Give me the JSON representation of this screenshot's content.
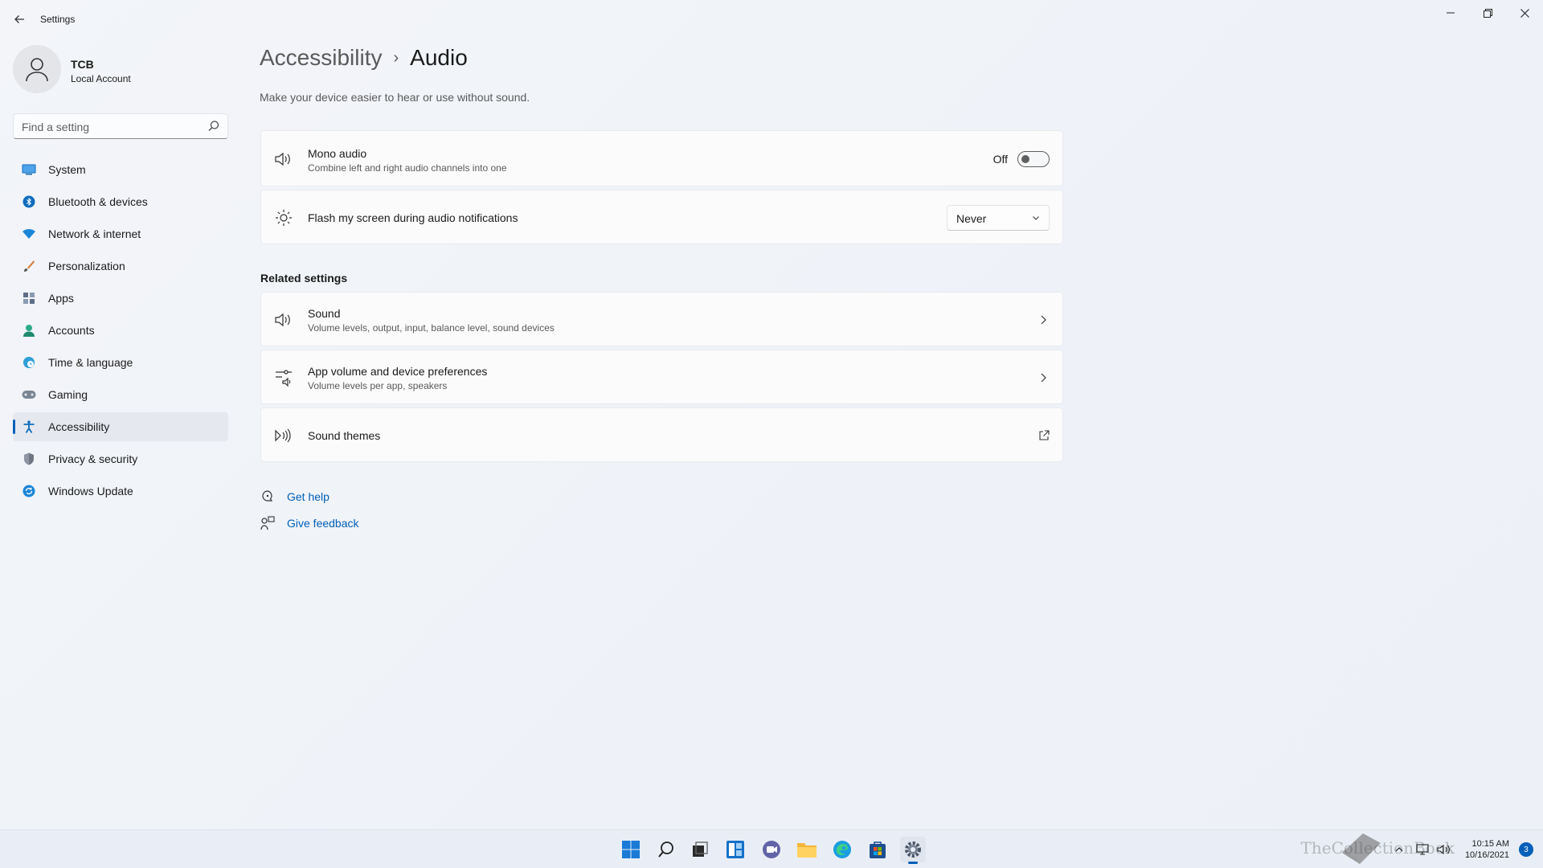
{
  "window": {
    "app_title": "Settings",
    "controls": {
      "minimize": "—",
      "maximize": "❐",
      "close": "✕"
    }
  },
  "profile": {
    "name": "TCB",
    "account_type": "Local Account"
  },
  "search": {
    "placeholder": "Find a setting"
  },
  "sidebar": {
    "items": [
      {
        "label": "System",
        "icon": "monitor-icon",
        "active": false
      },
      {
        "label": "Bluetooth & devices",
        "icon": "bluetooth-icon",
        "active": false
      },
      {
        "label": "Network & internet",
        "icon": "wifi-icon",
        "active": false
      },
      {
        "label": "Personalization",
        "icon": "brush-icon",
        "active": false
      },
      {
        "label": "Apps",
        "icon": "apps-icon",
        "active": false
      },
      {
        "label": "Accounts",
        "icon": "person-icon",
        "active": false
      },
      {
        "label": "Time & language",
        "icon": "globe-clock-icon",
        "active": false
      },
      {
        "label": "Gaming",
        "icon": "gamepad-icon",
        "active": false
      },
      {
        "label": "Accessibility",
        "icon": "accessibility-icon",
        "active": true
      },
      {
        "label": "Privacy & security",
        "icon": "shield-icon",
        "active": false
      },
      {
        "label": "Windows Update",
        "icon": "update-icon",
        "active": false
      }
    ]
  },
  "main": {
    "breadcrumb": {
      "parent": "Accessibility",
      "separator": "›",
      "current": "Audio"
    },
    "description": "Make your device easier to hear or use without sound.",
    "settings": {
      "mono_audio": {
        "title": "Mono audio",
        "subtitle": "Combine left and right audio channels into one",
        "toggle_state": "Off",
        "enabled": false
      },
      "flash_screen": {
        "title": "Flash my screen during audio notifications",
        "selected": "Never"
      }
    },
    "related": {
      "heading": "Related settings",
      "items": [
        {
          "title": "Sound",
          "subtitle": "Volume levels, output, input, balance level, sound devices",
          "icon": "speaker-icon",
          "action": "chevron-right-icon"
        },
        {
          "title": "App volume and device preferences",
          "subtitle": "Volume levels per app, speakers",
          "icon": "sliders-speaker-icon",
          "action": "chevron-right-icon"
        },
        {
          "title": "Sound themes",
          "subtitle": "",
          "icon": "sound-wave-icon",
          "action": "external-link-icon"
        }
      ]
    },
    "help": {
      "get_help": "Get help",
      "give_feedback": "Give feedback"
    }
  },
  "taskbar": {
    "apps": [
      "start",
      "search",
      "task-view",
      "widgets",
      "chat",
      "file-explorer",
      "edge",
      "store",
      "settings"
    ],
    "active_app": "settings",
    "clock": {
      "time": "10:15 AM",
      "date": "10/16/2021"
    },
    "notification_count": "3",
    "watermark": "TheCollectionBook"
  },
  "colors": {
    "accent": "#005fb8",
    "background": "#f0f4f9",
    "card": "#fbfbfc"
  }
}
